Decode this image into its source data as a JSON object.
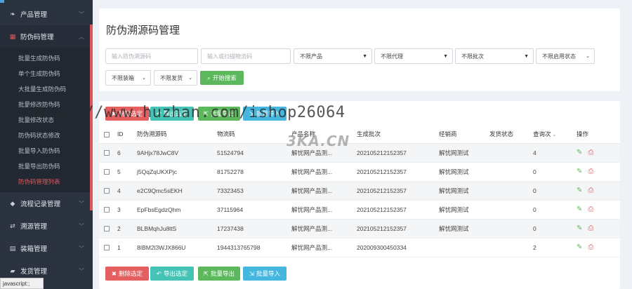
{
  "sidebar": {
    "groups": [
      {
        "label": "产品管理",
        "icon": "leaf-icon"
      },
      {
        "label": "防伪码管理",
        "icon": "grid-icon"
      },
      {
        "label": "流程记录管理",
        "icon": "tag-icon"
      },
      {
        "label": "溯源管理",
        "icon": "refresh-icon"
      },
      {
        "label": "装箱管理",
        "icon": "table-icon"
      },
      {
        "label": "发货管理",
        "icon": "truck-icon"
      }
    ],
    "sub_items": [
      "批量生成防伪码",
      "单个生成防伪码",
      "大批量生成防伪码",
      "批量修改防伪码",
      "批量修改状态",
      "防伪码状态修改",
      "批量导入防伪码",
      "批量导出防伪码",
      "防伪码管理列表"
    ]
  },
  "search": {
    "title": "防伪溯源码管理",
    "code_placeholder": "输入防伪溯源码",
    "logistics_placeholder": "输入或扫描物流码",
    "product_select": "不限产品",
    "agent_select": "不限代理",
    "batch_select": "不限批次",
    "enable_select": "不限启用状态",
    "box_select": "不限装箱",
    "ship_select": "不限发货",
    "search_button": "开始搜索"
  },
  "actions": {
    "delete": "删除选定",
    "export_selected": "导出选定",
    "batch_export": "批量导出",
    "batch_import": "批量导入"
  },
  "table": {
    "headers": [
      "ID",
      "防伪溯源码",
      "物流码",
      "产品名称",
      "生成批次",
      "经销商",
      "发货状态",
      "查询次",
      "操作"
    ],
    "rows": [
      {
        "id": "6",
        "code": "9AHjx78JwC8V",
        "logistics": "51524794",
        "product": "解忧网产品测...",
        "batch": "202105212152357",
        "dealer": "解忧网测试",
        "ship": "",
        "count": "4"
      },
      {
        "id": "5",
        "code": "j5QqZqUKXPjc",
        "logistics": "81752278",
        "product": "解忧网产品测...",
        "batch": "202105212152357",
        "dealer": "解忧网测试",
        "ship": "",
        "count": "0"
      },
      {
        "id": "4",
        "code": "e2C9Qmc5sEKH",
        "logistics": "73323453",
        "product": "解忧网产品测...",
        "batch": "202105212152357",
        "dealer": "解忧网测试",
        "ship": "",
        "count": "0"
      },
      {
        "id": "3",
        "code": "EpFbsEgdzQhm",
        "logistics": "37115964",
        "product": "解忧网产品测...",
        "batch": "202105212152357",
        "dealer": "解忧网测试",
        "ship": "",
        "count": "0"
      },
      {
        "id": "2",
        "code": "BLBMqhJu8ltS",
        "logistics": "17237438",
        "product": "解忧网产品测...",
        "batch": "202105212152357",
        "dealer": "解忧网测试",
        "ship": "",
        "count": "0"
      },
      {
        "id": "1",
        "code": "8IBM2l3WJX866U",
        "logistics": "1944313765798",
        "product": "解忧网产品测...",
        "batch": "202009300450334",
        "dealer": "",
        "ship": "",
        "count": "2"
      }
    ]
  },
  "overlay": {
    "watermark": "https://www.huzhan.com/ishop26064",
    "logo": "3KA.CN",
    "status": "javascript:;"
  },
  "colors": {
    "sidebar_bg": "#2b3340",
    "accent_red": "#e0575b",
    "green": "#5cb85c",
    "teal": "#45c3b4",
    "blue": "#45b7de"
  }
}
